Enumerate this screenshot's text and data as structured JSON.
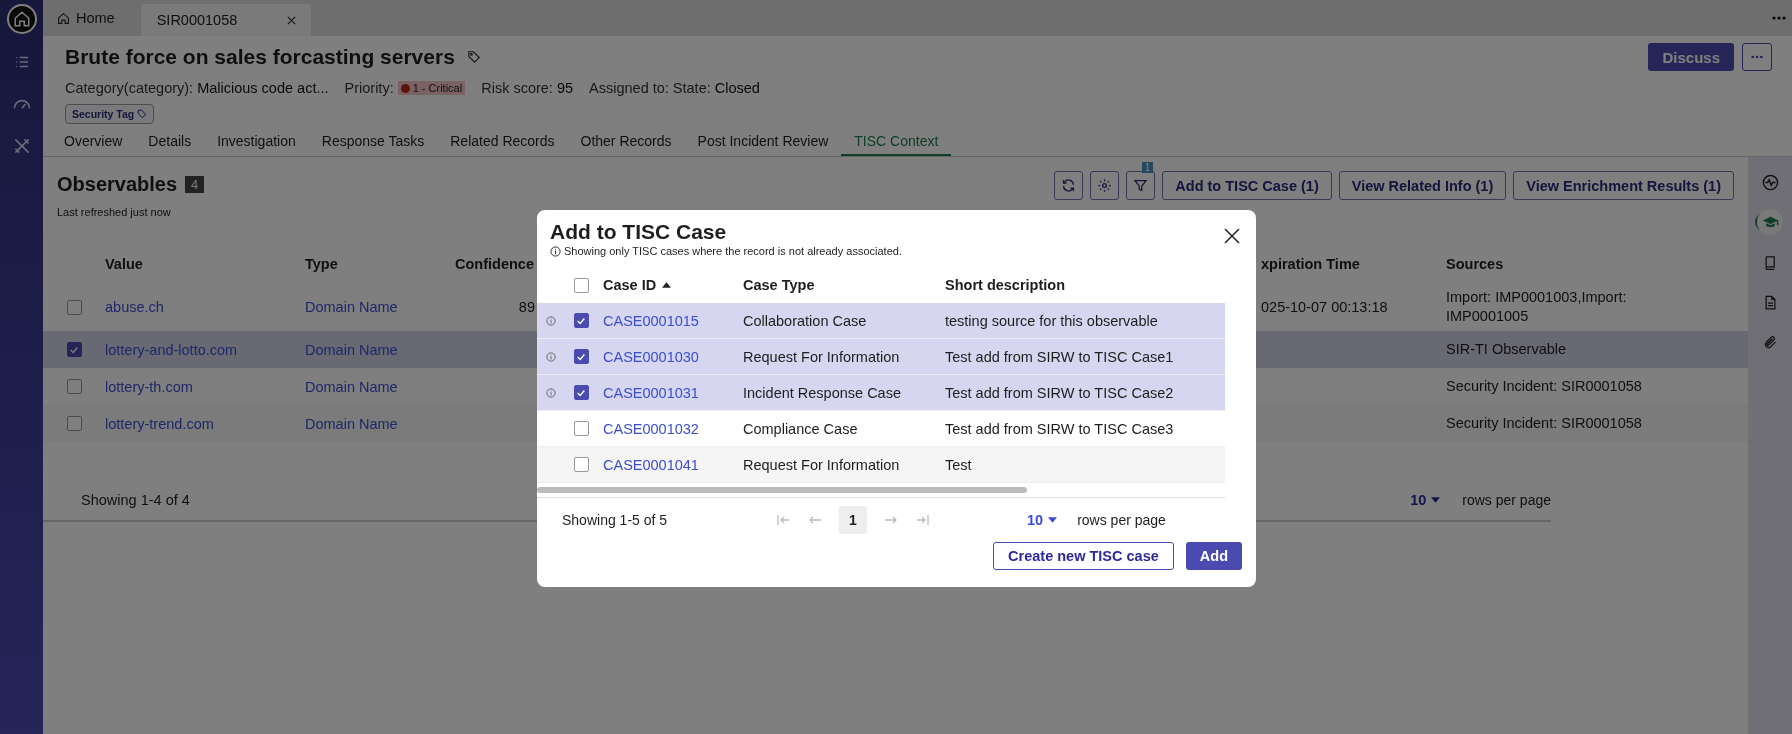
{
  "sidebar": {
    "items": [
      {
        "selected": true
      },
      {
        "selected": false
      },
      {
        "selected": false
      },
      {
        "selected": false
      }
    ]
  },
  "tabs": [
    {
      "label": "Home",
      "selected": false
    },
    {
      "label": "SIR0001058",
      "selected": true
    }
  ],
  "record": {
    "title": "Brute force on sales forcasting servers",
    "fields": [
      {
        "label": "Category(category):",
        "value": "Malicious code act...",
        "kind": "text"
      },
      {
        "label": "Priority:",
        "value": "1 - Critical",
        "kind": "badge"
      },
      {
        "label": "Risk score:",
        "value": "95",
        "kind": "text"
      },
      {
        "label": "Assigned to:",
        "kind": "text"
      },
      {
        "label": "State:",
        "value": "Closed",
        "kind": "text"
      }
    ],
    "tags": [
      "Security Tag"
    ],
    "discuss": "Discuss"
  },
  "section_tabs": [
    {
      "label": "Overview",
      "selected": false
    },
    {
      "label": "Details",
      "selected": false
    },
    {
      "label": "Investigation",
      "selected": false
    },
    {
      "label": "Response Tasks",
      "selected": false
    },
    {
      "label": "Related Records",
      "selected": false
    },
    {
      "label": "Other Records",
      "selected": false
    },
    {
      "label": "Post Incident Review",
      "selected": false
    },
    {
      "label": "TISC Context",
      "selected": true
    }
  ],
  "observables": {
    "title": "Observables",
    "count": "4",
    "refreshed": "Last refreshed just now",
    "filter_count": "1",
    "buttons": [
      "Add to TISC Case (1)",
      "View Related Info (1)",
      "View Enrichment Results (1)"
    ],
    "columns": [
      "Value",
      "Type",
      "Confidence",
      "xpiration Time",
      "Sources"
    ],
    "rows": [
      {
        "value": "abuse.ch",
        "type": "Domain Name",
        "confidence": "89",
        "expiration": "025-10-07 00:13:18",
        "sources": "Import: IMP0001003,Import: IMP0001005",
        "selected": false
      },
      {
        "value": "lottery-and-lotto.com",
        "type": "Domain Name",
        "sources": "SIR-TI Observable",
        "selected": true
      },
      {
        "value": "lottery-th.com",
        "type": "Domain Name",
        "sources": "Security Incident: SIR0001058",
        "selected": false
      },
      {
        "value": "lottery-trend.com",
        "type": "Domain Name",
        "sources": "Security Incident: SIR0001058",
        "selected": false
      }
    ],
    "showing": "Showing 1-4 of 4",
    "page_size": "10",
    "rows_per_page": "rows per page"
  },
  "right_rail": {
    "items": [
      {
        "selected": false
      },
      {
        "selected": true
      },
      {
        "selected": false
      },
      {
        "selected": false
      },
      {
        "selected": false
      }
    ]
  },
  "modal": {
    "title": "Add to TISC Case",
    "note": "Showing only TISC cases where the record is not already associated.",
    "all_selected": false,
    "sort_ascending": true,
    "columns": [
      "Case ID",
      "Case Type",
      "Short description"
    ],
    "rows": [
      {
        "case_id": "CASE0001015",
        "case_type": "Collaboration Case",
        "description": "testing source for this observable",
        "selected": true
      },
      {
        "case_id": "CASE0001030",
        "case_type": "Request For Information",
        "description": "Test add from SIRW to TISC Case1",
        "selected": true
      },
      {
        "case_id": "CASE0001031",
        "case_type": "Incident Response Case",
        "description": "Test add from SIRW to TISC Case2",
        "selected": true
      },
      {
        "case_id": "CASE0001032",
        "case_type": "Compliance Case",
        "description": "Test add from SIRW to TISC Case3",
        "selected": false
      },
      {
        "case_id": "CASE0001041",
        "case_type": "Request For Information",
        "description": "Test",
        "selected": false
      }
    ],
    "showing": "Showing 1-5 of 5",
    "page": "1",
    "page_size": "10",
    "rows_per_page": "rows per page",
    "create_button": "Create new TISC case",
    "add_button": "Add"
  }
}
